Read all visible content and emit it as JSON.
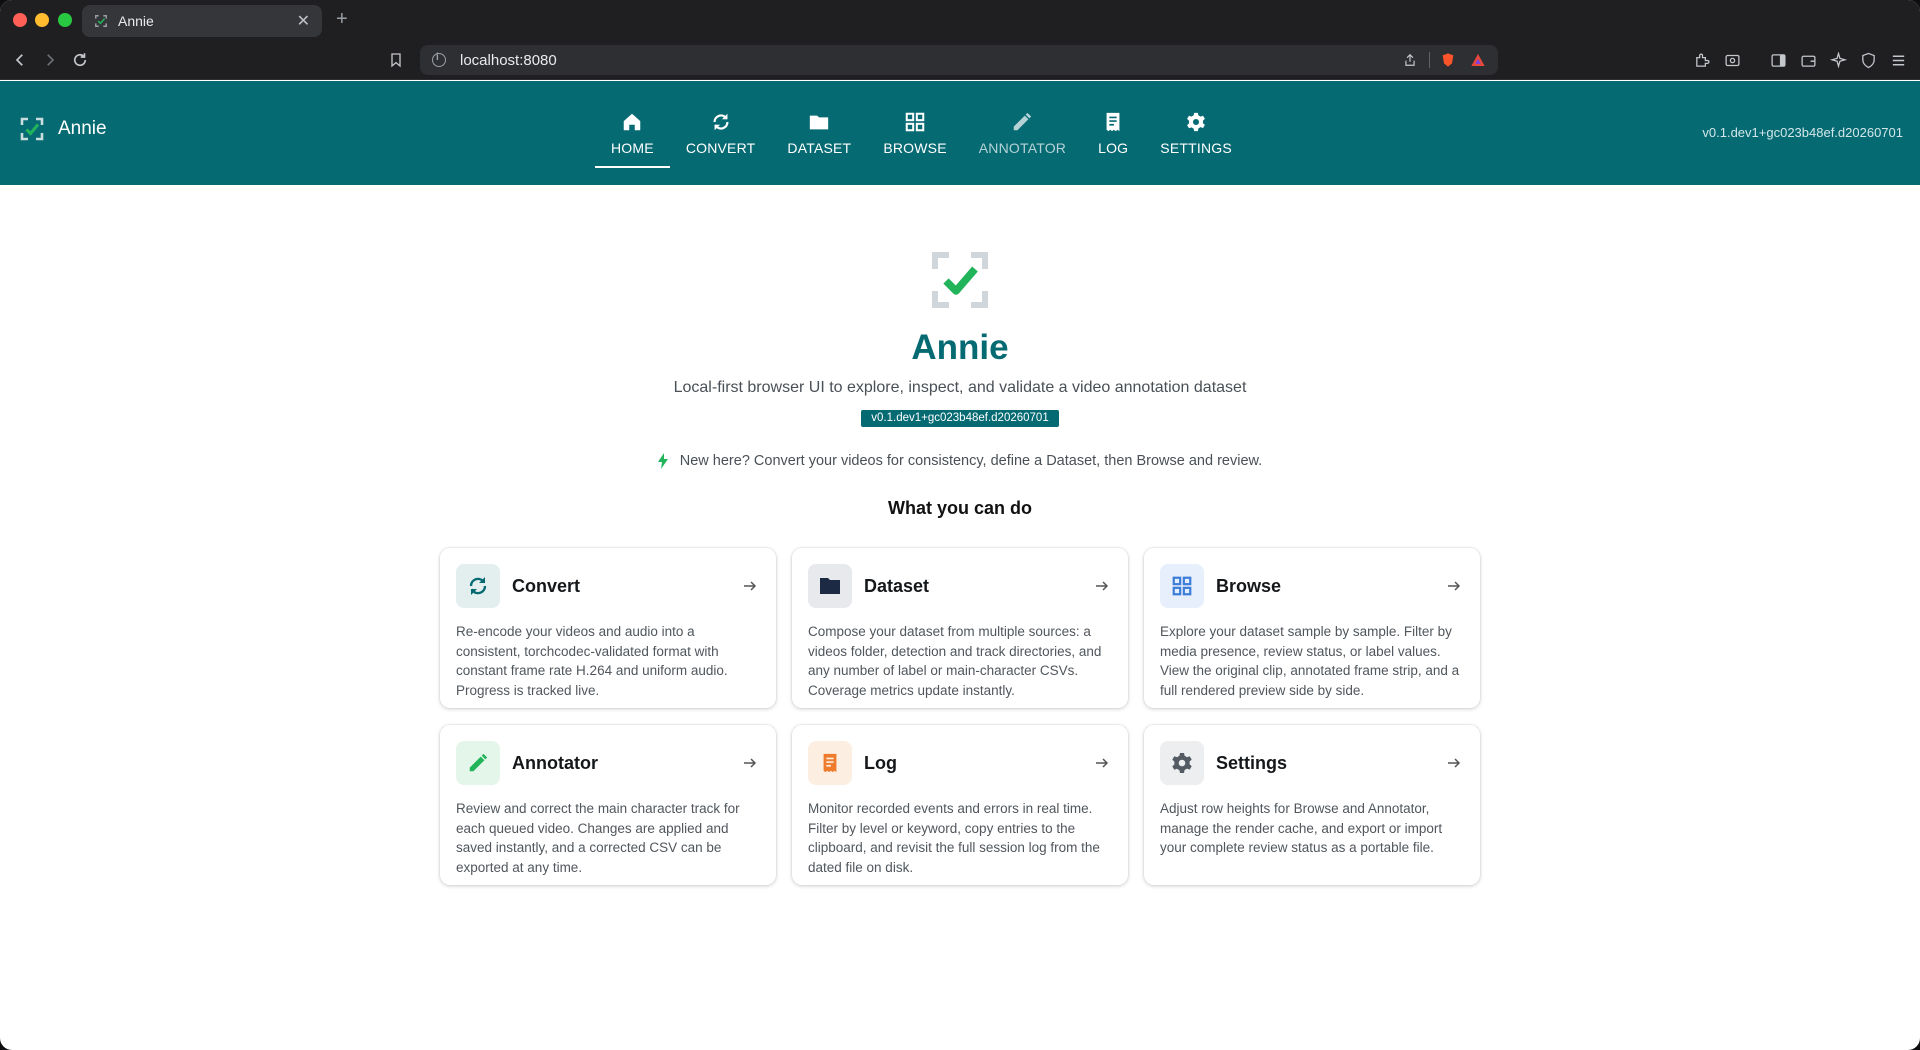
{
  "browser": {
    "tab_title": "Annie",
    "url": "localhost:8080"
  },
  "header": {
    "brand": "Annie",
    "version": "v0.1.dev1+gc023b48ef.d20260701",
    "nav": [
      {
        "label": "HOME",
        "icon": "home-icon",
        "active": true
      },
      {
        "label": "CONVERT",
        "icon": "sync-icon"
      },
      {
        "label": "DATASET",
        "icon": "folder-icon"
      },
      {
        "label": "BROWSE",
        "icon": "grid-icon"
      },
      {
        "label": "ANNOTATOR",
        "icon": "pencil-icon",
        "dim": true
      },
      {
        "label": "LOG",
        "icon": "receipt-icon"
      },
      {
        "label": "SETTINGS",
        "icon": "gear-icon"
      }
    ]
  },
  "hero": {
    "title": "Annie",
    "subtitle": "Local-first browser UI to explore, inspect, and validate a video annotation dataset",
    "version_badge": "v0.1.dev1+gc023b48ef.d20260701",
    "tip": "New here? Convert your videos for consistency, define a Dataset, then Browse and review."
  },
  "features": {
    "heading": "What you can do",
    "cards": [
      {
        "title": "Convert",
        "icon": "sync-icon",
        "description": "Re-encode your videos and audio into a consistent, torchcodec-validated format with constant frame rate H.264 and uniform audio. Progress is tracked live."
      },
      {
        "title": "Dataset",
        "icon": "folder-icon",
        "description": "Compose your dataset from multiple sources: a videos folder, detection and track directories, and any number of label or main-character CSVs. Coverage metrics update instantly."
      },
      {
        "title": "Browse",
        "icon": "grid-icon",
        "description": "Explore your dataset sample by sample. Filter by media presence, review status, or label values. View the original clip, annotated frame strip, and a full rendered preview side by side."
      },
      {
        "title": "Annotator",
        "icon": "pencil-icon",
        "description": "Review and correct the main character track for each queued video. Changes are applied and saved instantly, and a corrected CSV can be exported at any time."
      },
      {
        "title": "Log",
        "icon": "receipt-icon",
        "description": "Monitor recorded events and errors in real time. Filter by level or keyword, copy entries to the clipboard, and revisit the full session log from the dated file on disk."
      },
      {
        "title": "Settings",
        "icon": "gear-icon",
        "description": "Adjust row heights for Browse and Annotator, manage the render cache, and export or import your complete review status as a portable file."
      }
    ]
  },
  "colors": {
    "primary": "#066a73",
    "success": "#22b45a"
  }
}
